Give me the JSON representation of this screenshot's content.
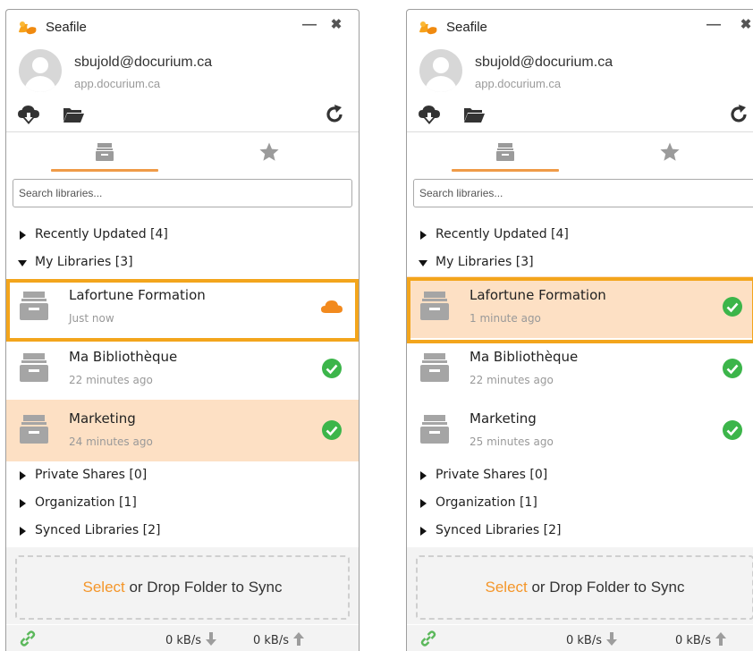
{
  "panels": [
    {
      "app_title": "Seafile",
      "account": {
        "email": "sbujold@docurium.ca",
        "server": "app.docurium.ca"
      },
      "search": {
        "placeholder": "Search libraries..."
      },
      "groups": {
        "recent": "Recently Updated [4]",
        "mine": "My Libraries [3]",
        "private": "Private Shares [0]",
        "org": "Organization [1]",
        "synced": "Synced Libraries [2]"
      },
      "libraries": [
        {
          "name": "Lafortune Formation",
          "time": "Just now",
          "status": "syncing-cloud-icon"
        },
        {
          "name": "Ma Bibliothèque",
          "time": "22 minutes ago",
          "status": "synced-check-icon"
        },
        {
          "name": "Marketing",
          "time": "24 minutes ago",
          "status": "synced-check-icon"
        }
      ],
      "drop": {
        "select": "Select",
        "rest": " or Drop Folder to Sync"
      },
      "rates": {
        "down": "0 kB/s",
        "up": "0 kB/s"
      }
    },
    {
      "app_title": "Seafile",
      "account": {
        "email": "sbujold@docurium.ca",
        "server": "app.docurium.ca"
      },
      "search": {
        "placeholder": "Search libraries..."
      },
      "groups": {
        "recent": "Recently Updated [4]",
        "mine": "My Libraries [3]",
        "private": "Private Shares [0]",
        "org": "Organization [1]",
        "synced": "Synced Libraries [2]"
      },
      "libraries": [
        {
          "name": "Lafortune Formation",
          "time": "1 minute ago",
          "status": "synced-check-icon"
        },
        {
          "name": "Ma Bibliothèque",
          "time": "22 minutes ago",
          "status": "synced-check-icon"
        },
        {
          "name": "Marketing",
          "time": "25 minutes ago",
          "status": "synced-check-icon"
        }
      ],
      "drop": {
        "select": "Select",
        "rest": " or Drop Folder to Sync"
      },
      "rates": {
        "down": "0 kB/s",
        "up": "0 kB/s"
      }
    }
  ],
  "colors": {
    "accent": "#f09b48",
    "highlight_border": "#f3a51c",
    "hover_row": "#fde0c4",
    "synced_green": "#3cb54a",
    "syncing_orange": "#f28a1e"
  }
}
